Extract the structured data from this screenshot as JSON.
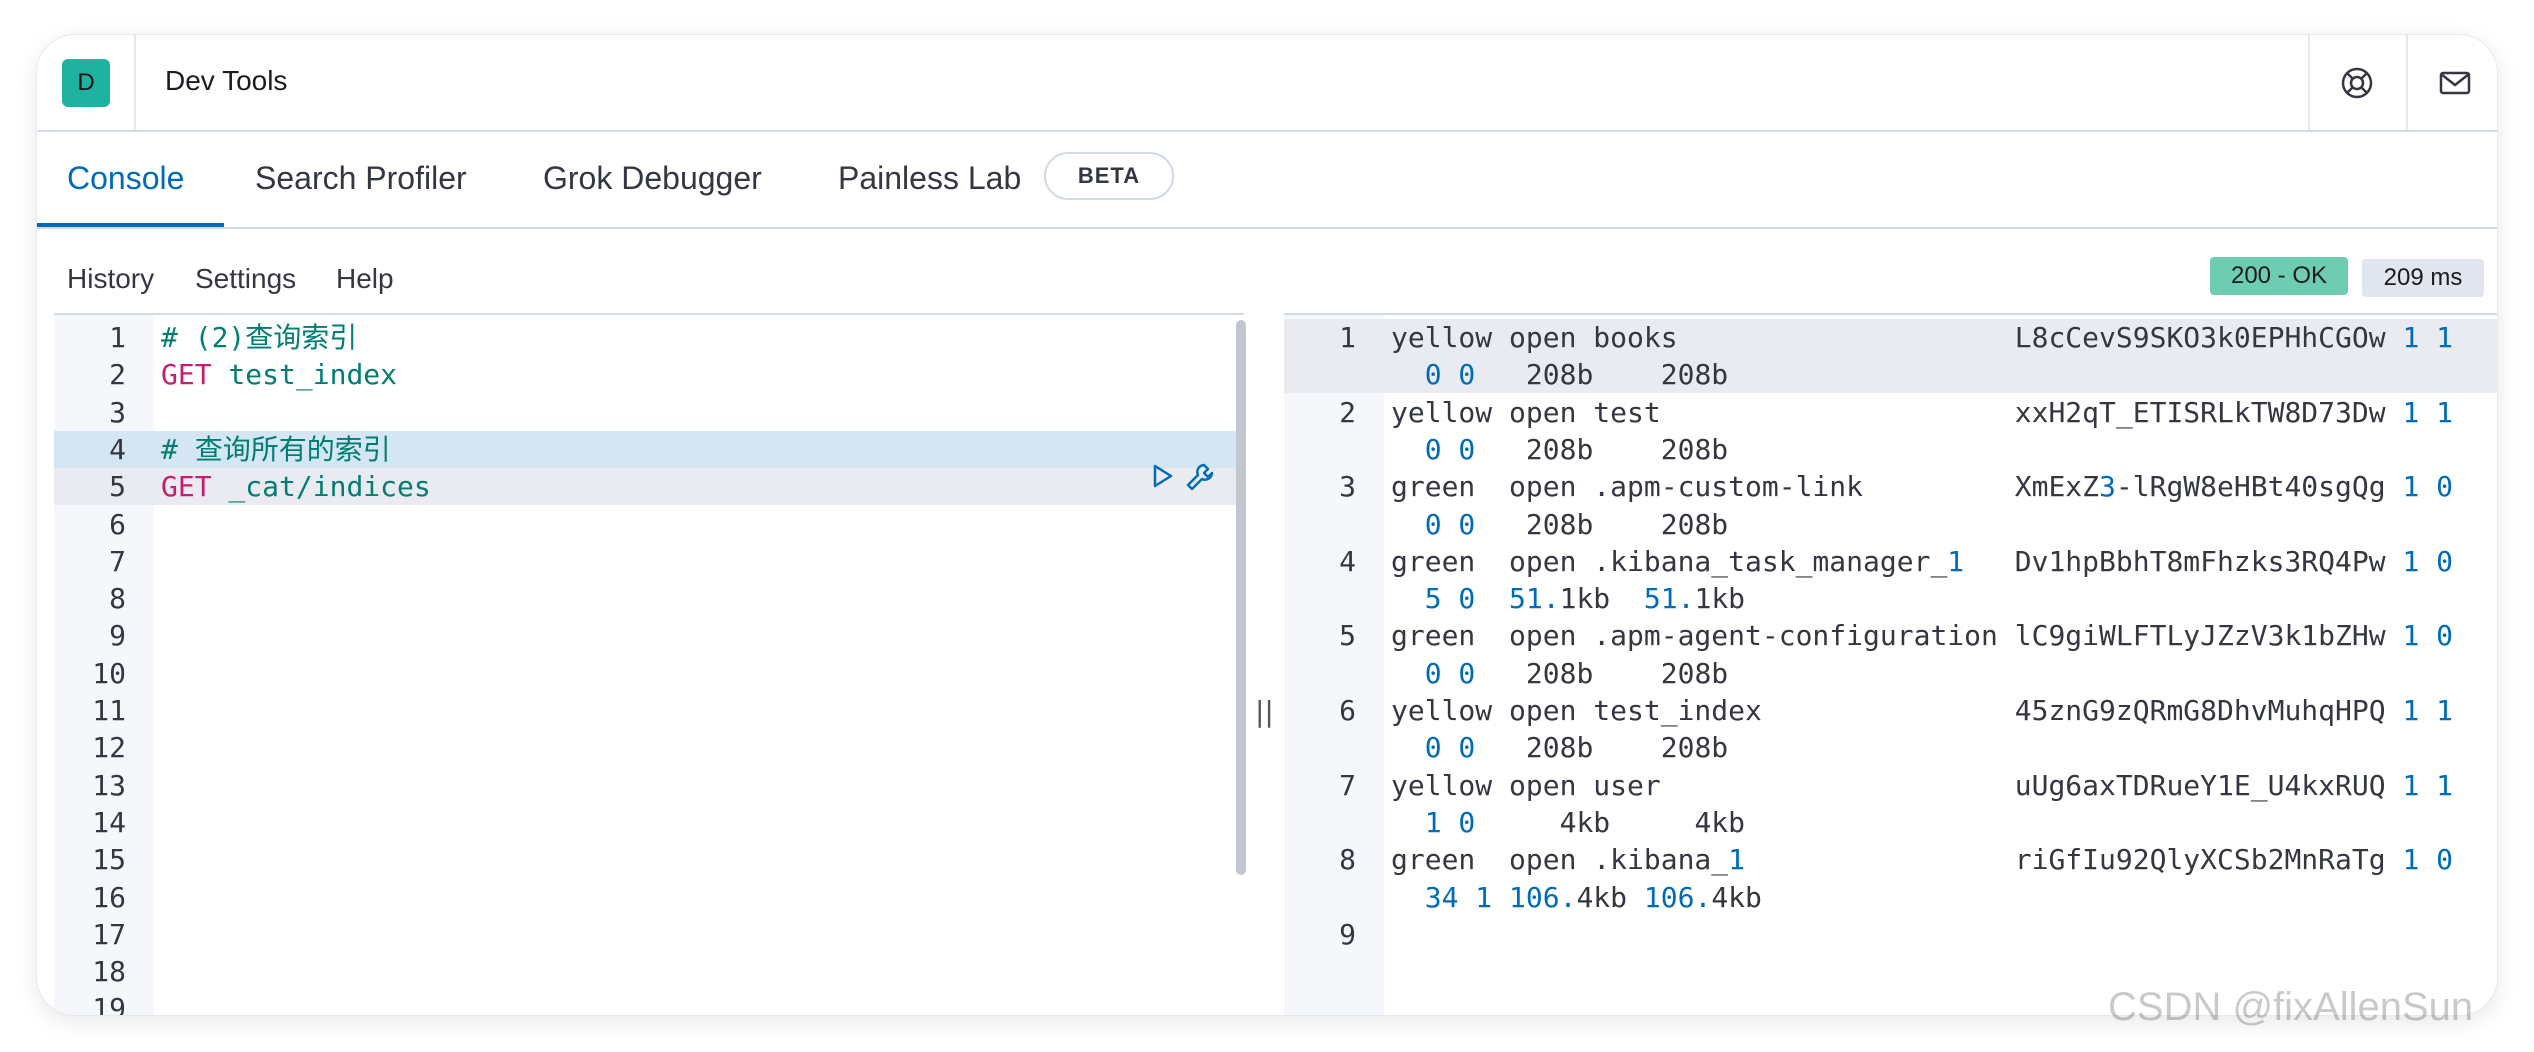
{
  "header": {
    "logo_letter": "D",
    "title": "Dev Tools",
    "icons": [
      "help-icon",
      "mail-icon"
    ]
  },
  "tabs": [
    {
      "label": "Console",
      "active": true
    },
    {
      "label": "Search Profiler",
      "active": false
    },
    {
      "label": "Grok Debugger",
      "active": false
    },
    {
      "label": "Painless Lab",
      "active": false,
      "badge": "BETA"
    }
  ],
  "toolbar": {
    "history": "History",
    "settings": "Settings",
    "help": "Help",
    "status": "200 - OK",
    "time": "209 ms"
  },
  "request_editor": {
    "lines": [
      {
        "num": "1",
        "tokens": [
          {
            "t": "# (2)查询索引",
            "c": "comment"
          }
        ]
      },
      {
        "num": "2",
        "tokens": [
          {
            "t": "GET",
            "c": "method"
          },
          {
            "t": " test_index",
            "c": "path"
          }
        ]
      },
      {
        "num": "3",
        "tokens": []
      },
      {
        "num": "4",
        "tokens": [
          {
            "t": "# 查询所有的索引",
            "c": "comment"
          }
        ]
      },
      {
        "num": "5",
        "tokens": [
          {
            "t": "GET",
            "c": "method"
          },
          {
            "t": " _cat/indices",
            "c": "path"
          }
        ]
      },
      {
        "num": "6",
        "tokens": []
      },
      {
        "num": "7",
        "tokens": []
      },
      {
        "num": "8",
        "tokens": []
      },
      {
        "num": "9",
        "tokens": []
      },
      {
        "num": "10",
        "tokens": []
      },
      {
        "num": "11",
        "tokens": []
      },
      {
        "num": "12",
        "tokens": []
      },
      {
        "num": "13",
        "tokens": []
      },
      {
        "num": "14",
        "tokens": []
      },
      {
        "num": "15",
        "tokens": []
      },
      {
        "num": "16",
        "tokens": []
      },
      {
        "num": "17",
        "tokens": []
      },
      {
        "num": "18",
        "tokens": []
      },
      {
        "num": "19",
        "tokens": []
      }
    ]
  },
  "response_editor": {
    "lines": [
      {
        "num": "1",
        "tokens": [
          {
            "t": "yellow open books                    L8cCevS9SKO3k0EPHhCGOw ",
            "c": "text"
          },
          {
            "t": "1 1",
            "c": "num"
          }
        ]
      },
      {
        "num": "",
        "tokens": [
          {
            "t": "  ",
            "c": "text"
          },
          {
            "t": "0 0",
            "c": "num"
          },
          {
            "t": "   208b    208b",
            "c": "text"
          }
        ]
      },
      {
        "num": "2",
        "tokens": [
          {
            "t": "yellow open test                     xxH2qT_ETISRLkTW8D73Dw ",
            "c": "text"
          },
          {
            "t": "1 1",
            "c": "num"
          }
        ]
      },
      {
        "num": "",
        "tokens": [
          {
            "t": "  ",
            "c": "text"
          },
          {
            "t": "0 0",
            "c": "num"
          },
          {
            "t": "   208b    208b",
            "c": "text"
          }
        ]
      },
      {
        "num": "3",
        "tokens": [
          {
            "t": "green  open .apm-custom-link         XmExZ",
            "c": "text"
          },
          {
            "t": "3",
            "c": "num"
          },
          {
            "t": "-lRgW8eHBt40sgQg ",
            "c": "text"
          },
          {
            "t": "1 0",
            "c": "num"
          }
        ]
      },
      {
        "num": "",
        "tokens": [
          {
            "t": "  ",
            "c": "text"
          },
          {
            "t": "0 0",
            "c": "num"
          },
          {
            "t": "   208b    208b",
            "c": "text"
          }
        ]
      },
      {
        "num": "4",
        "tokens": [
          {
            "t": "green  open .kibana_task_manager_",
            "c": "text"
          },
          {
            "t": "1",
            "c": "num"
          },
          {
            "t": "   Dv1hpBbhT8mFhzks3RQ4Pw ",
            "c": "text"
          },
          {
            "t": "1 0",
            "c": "num"
          }
        ]
      },
      {
        "num": "",
        "tokens": [
          {
            "t": "  ",
            "c": "text"
          },
          {
            "t": "5 0",
            "c": "num"
          },
          {
            "t": "  ",
            "c": "text"
          },
          {
            "t": "51.",
            "c": "num"
          },
          {
            "t": "1kb  ",
            "c": "text"
          },
          {
            "t": "51.",
            "c": "num"
          },
          {
            "t": "1kb",
            "c": "text"
          }
        ]
      },
      {
        "num": "5",
        "tokens": [
          {
            "t": "green  open .apm-agent-configuration lC9giWLFTLyJZzV3k1bZHw ",
            "c": "text"
          },
          {
            "t": "1 0",
            "c": "num"
          }
        ]
      },
      {
        "num": "",
        "tokens": [
          {
            "t": "  ",
            "c": "text"
          },
          {
            "t": "0 0",
            "c": "num"
          },
          {
            "t": "   208b    208b",
            "c": "text"
          }
        ]
      },
      {
        "num": "6",
        "tokens": [
          {
            "t": "yellow open test_index               45znG9zQRmG8DhvMuhqHPQ ",
            "c": "text"
          },
          {
            "t": "1 1",
            "c": "num"
          }
        ]
      },
      {
        "num": "",
        "tokens": [
          {
            "t": "  ",
            "c": "text"
          },
          {
            "t": "0 0",
            "c": "num"
          },
          {
            "t": "   208b    208b",
            "c": "text"
          }
        ]
      },
      {
        "num": "7",
        "tokens": [
          {
            "t": "yellow open user                     uUg6axTDRueY1E_U4kxRUQ ",
            "c": "text"
          },
          {
            "t": "1 1",
            "c": "num"
          }
        ]
      },
      {
        "num": "",
        "tokens": [
          {
            "t": "  ",
            "c": "text"
          },
          {
            "t": "1 0",
            "c": "num"
          },
          {
            "t": "     4kb     4kb",
            "c": "text"
          }
        ]
      },
      {
        "num": "8",
        "tokens": [
          {
            "t": "green  open .kibana_",
            "c": "text"
          },
          {
            "t": "1",
            "c": "num"
          },
          {
            "t": "                riGfIu92QlyXCSb2MnRaTg ",
            "c": "text"
          },
          {
            "t": "1 0",
            "c": "num"
          }
        ]
      },
      {
        "num": "",
        "tokens": [
          {
            "t": "  ",
            "c": "text"
          },
          {
            "t": "34 1",
            "c": "num"
          },
          {
            "t": " ",
            "c": "text"
          },
          {
            "t": "106.",
            "c": "num"
          },
          {
            "t": "4kb ",
            "c": "text"
          },
          {
            "t": "106.",
            "c": "num"
          },
          {
            "t": "4kb",
            "c": "text"
          }
        ]
      },
      {
        "num": "9",
        "tokens": []
      }
    ]
  },
  "watermark": "CSDN @fixAllenSun"
}
